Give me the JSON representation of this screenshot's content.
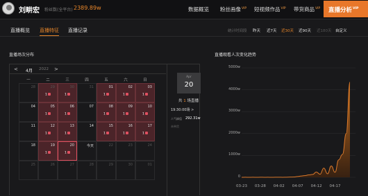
{
  "header": {
    "name": "刘畊宏",
    "fans_label": "粉丝数(全平台)",
    "fans_value": "2389.89w",
    "nav": [
      "数据概览",
      "粉丝画像",
      "短视频作品",
      "带货商品"
    ],
    "nav_vip": "VIP",
    "active_nav": "直播分析",
    "active_vip": "VIP"
  },
  "subnav": {
    "tabs": [
      "直播概览",
      "直播特征",
      "直播记录"
    ],
    "active_tab_index": 1,
    "range_label": "统计时间段",
    "ranges": [
      "昨天",
      "近7天",
      "近30天",
      "近90天",
      "近180天",
      "自定义"
    ],
    "active_range_index": 2
  },
  "calendar": {
    "title": "直播场次分布",
    "prev": "<",
    "next": ">",
    "month": "4月",
    "year": "2022",
    "weekdays": [
      "一",
      "二",
      "三",
      "四",
      "五",
      "六",
      "日"
    ],
    "cells": [
      {
        "day": "28",
        "dim": true,
        "badge": ""
      },
      {
        "day": "29",
        "dim": true,
        "badge": "1"
      },
      {
        "day": "30",
        "dim": true,
        "badge": "1"
      },
      {
        "day": "31",
        "dim": true,
        "badge": ""
      },
      {
        "day": "01",
        "dim": false,
        "badge": "1"
      },
      {
        "day": "02",
        "dim": false,
        "badge": "1"
      },
      {
        "day": "03",
        "dim": false,
        "badge": "1"
      },
      {
        "day": "04",
        "dim": false,
        "badge": ""
      },
      {
        "day": "05",
        "dim": false,
        "badge": "1"
      },
      {
        "day": "06",
        "dim": false,
        "badge": "1"
      },
      {
        "day": "07",
        "dim": false,
        "badge": ""
      },
      {
        "day": "08",
        "dim": false,
        "badge": "1"
      },
      {
        "day": "09",
        "dim": false,
        "badge": "1"
      },
      {
        "day": "10",
        "dim": false,
        "badge": "1"
      },
      {
        "day": "11",
        "dim": false,
        "badge": ""
      },
      {
        "day": "12",
        "dim": false,
        "badge": "1"
      },
      {
        "day": "13",
        "dim": false,
        "badge": "1"
      },
      {
        "day": "14",
        "dim": false,
        "badge": ""
      },
      {
        "day": "15",
        "dim": false,
        "badge": "1"
      },
      {
        "day": "16",
        "dim": false,
        "badge": "1"
      },
      {
        "day": "17",
        "dim": false,
        "badge": "1"
      },
      {
        "day": "18",
        "dim": false,
        "badge": ""
      },
      {
        "day": "19",
        "dim": false,
        "badge": "1"
      },
      {
        "day": "20",
        "dim": false,
        "badge": "1"
      },
      {
        "day": "今天",
        "dim": false,
        "badge": ""
      },
      {
        "day": "22",
        "dim": true,
        "badge": ""
      },
      {
        "day": "23",
        "dim": true,
        "badge": ""
      },
      {
        "day": "24",
        "dim": true,
        "badge": ""
      },
      {
        "day": "25",
        "dim": true,
        "badge": ""
      },
      {
        "day": "26",
        "dim": true,
        "badge": ""
      },
      {
        "day": "27",
        "dim": true,
        "badge": ""
      },
      {
        "day": "28",
        "dim": true,
        "badge": ""
      },
      {
        "day": "29",
        "dim": true,
        "badge": ""
      },
      {
        "day": "30",
        "dim": true,
        "badge": ""
      },
      {
        "day": "01",
        "dim": true,
        "badge": ""
      }
    ],
    "selected_index": 23,
    "side": {
      "month": "Apr",
      "day": "20",
      "count_prefix": "共",
      "count": "1",
      "count_suffix": "场直播",
      "session_time": "19:30:00场",
      "session_arrow": ">",
      "audience_label": "人气峰值",
      "audience_value": "292.31w",
      "no_cargo": "未带货"
    }
  },
  "trend_title": "直播观看人次变化趋势",
  "chart_data": {
    "type": "area",
    "title": "",
    "xlabel": "",
    "ylabel": "",
    "x_ticks": [
      "03-23",
      "03-28",
      "04-02",
      "04-07",
      "04-12",
      "04-17"
    ],
    "y_ticks": [
      "5000w",
      "4000w",
      "3000w",
      "2000w",
      "1000w",
      "0"
    ],
    "ylim": [
      0,
      5000
    ],
    "x_range_days": [
      0,
      29
    ],
    "series": [
      {
        "values": [
          [
            0,
            0
          ],
          [
            1,
            2
          ],
          [
            2,
            0
          ],
          [
            3,
            2
          ],
          [
            4,
            0
          ],
          [
            5,
            3
          ],
          [
            6,
            1
          ],
          [
            7,
            2
          ],
          [
            8,
            0
          ],
          [
            9,
            2
          ],
          [
            10,
            3
          ],
          [
            11,
            1
          ],
          [
            12,
            5
          ],
          [
            13,
            10
          ],
          [
            14,
            15
          ],
          [
            15,
            35
          ],
          [
            16,
            60
          ],
          [
            17,
            80
          ],
          [
            18,
            110
          ],
          [
            19,
            130
          ],
          [
            20,
            240
          ],
          [
            21,
            140
          ],
          [
            22,
            420
          ],
          [
            23,
            160
          ],
          [
            24,
            520
          ],
          [
            25,
            230
          ],
          [
            26,
            800
          ],
          [
            27,
            1050
          ],
          [
            28,
            2000
          ],
          [
            29,
            4350
          ]
        ]
      }
    ],
    "colors": {
      "line": "#d9782b",
      "fill_top": "#c7701f",
      "fill_bottom": "#3b2210"
    },
    "grid": true
  }
}
